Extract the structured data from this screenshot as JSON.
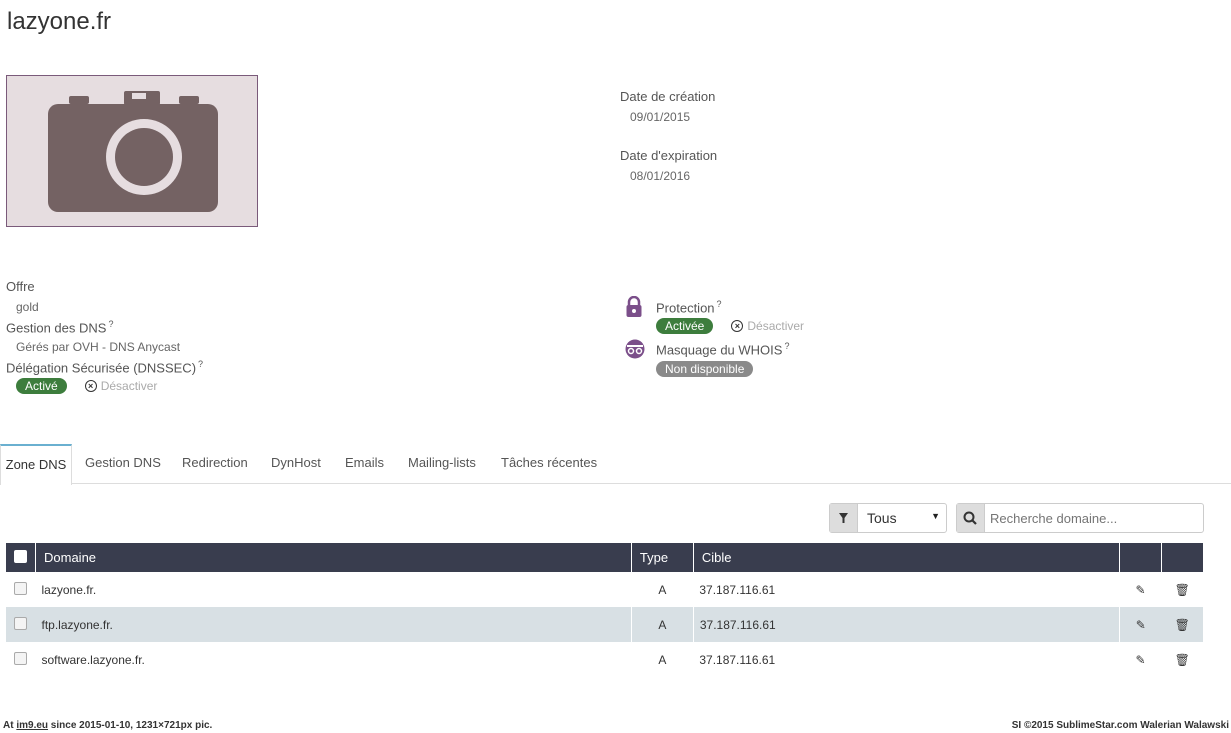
{
  "domain_title": "lazyone.fr",
  "dates": {
    "creation_label": "Date de création",
    "creation_value": "09/01/2015",
    "expiration_label": "Date d'expiration",
    "expiration_value": "08/01/2016"
  },
  "offer": {
    "label": "Offre",
    "value": "gold"
  },
  "dns_management": {
    "label": "Gestion des DNS",
    "help": "?",
    "value": "Gérés par OVH - DNS Anycast"
  },
  "dnssec": {
    "label": "Délégation Sécurisée (DNSSEC)",
    "help": "?",
    "status": "Activé",
    "action": "Désactiver"
  },
  "protection": {
    "label": "Protection",
    "help": "?",
    "status": "Activée",
    "action": "Désactiver"
  },
  "whois": {
    "label": "Masquage du WHOIS",
    "help": "?",
    "status": "Non disponible"
  },
  "tabs": [
    {
      "label": "Zone DNS",
      "active": true
    },
    {
      "label": "Gestion DNS"
    },
    {
      "label": "Redirection"
    },
    {
      "label": "DynHost"
    },
    {
      "label": "Emails"
    },
    {
      "label": "Mailing-lists"
    },
    {
      "label": "Tâches récentes"
    }
  ],
  "filter": {
    "selected": "Tous",
    "icon": "filter-icon"
  },
  "search": {
    "placeholder": "Recherche domaine...",
    "icon": "search-icon"
  },
  "table": {
    "columns": [
      "Domaine",
      "Type",
      "Cible"
    ],
    "rows": [
      {
        "domain": "lazyone.fr.",
        "type": "A",
        "target": "37.187.116.61"
      },
      {
        "domain": "ftp.lazyone.fr.",
        "type": "A",
        "target": "37.187.116.61"
      },
      {
        "domain": "software.lazyone.fr.",
        "type": "A",
        "target": "37.187.116.61"
      }
    ]
  },
  "footer": {
    "left_prefix": "At ",
    "left_link": "im9.eu",
    "left_suffix": " since 2015-01-10, 1231×721px pic.",
    "right": "SI ©2015 SublimeStar.com Walerian Walawski"
  },
  "colors": {
    "header_bg": "#393d4e",
    "badge_green": "#3d7d3d",
    "badge_gray": "#8a8a8a",
    "row_alt": "#d8e0e4",
    "accent_purple": "#7b4f8a"
  }
}
